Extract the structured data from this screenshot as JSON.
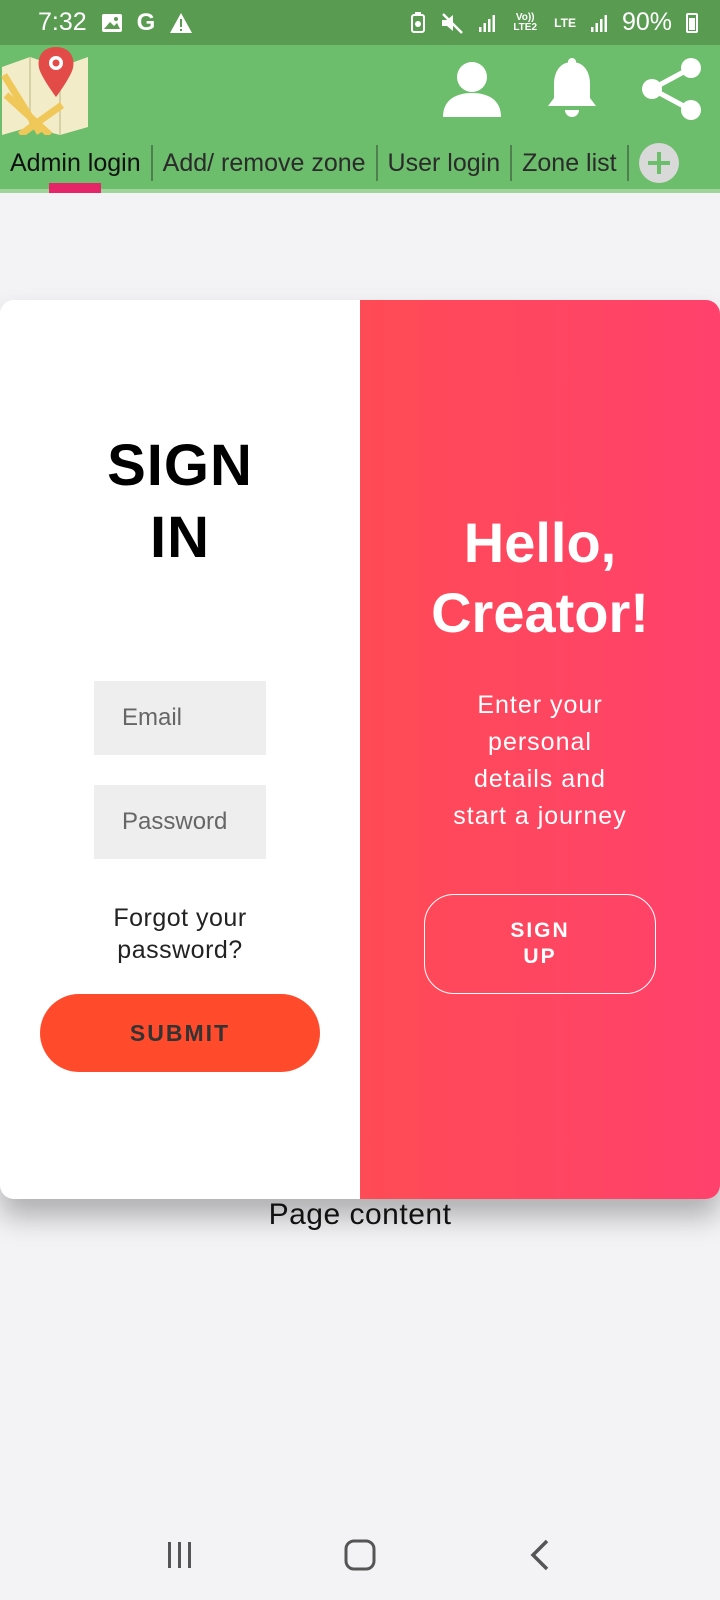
{
  "status_bar": {
    "time": "7:32",
    "battery": "90%",
    "icons": [
      "image-icon",
      "google-icon",
      "warning-icon",
      "cast-icon",
      "mute-icon",
      "signal-icon",
      "volte-icon",
      "lte-icon",
      "signal-icon-2",
      "battery-icon"
    ],
    "volte_label": "Vo)) LTE2",
    "lte_label": "LTE"
  },
  "app_bar": {
    "background_color": "#6cbd6c",
    "icons": [
      "map-logo-icon",
      "user-icon",
      "bell-icon",
      "share-icon"
    ],
    "tabs": [
      {
        "label": "Admin login",
        "active": true
      },
      {
        "label": "Add/ remove zone",
        "active": false
      },
      {
        "label": "User login",
        "active": false
      },
      {
        "label": "Zone list",
        "active": false
      }
    ],
    "add_tab_icon": "plus-icon",
    "active_indicator_color": "#e52567"
  },
  "signin": {
    "title_line1": "SIGN",
    "title_line2": "IN",
    "email_placeholder": "Email",
    "password_placeholder": "Password",
    "forgot_line1": "Forgot your",
    "forgot_line2": "password?",
    "submit_label": "SUBMIT",
    "submit_color": "#ff4b2b"
  },
  "welcome": {
    "title_line1": "Hello,",
    "title_line2": "Creator!",
    "subtitle_lines": [
      "Enter your",
      "personal",
      "details and",
      "start a journey"
    ],
    "signup_line1": "SIGN",
    "signup_line2": "UP",
    "gradient_colors": [
      "#ff4b55",
      "#ff416c"
    ]
  },
  "page_content_label": "Page content",
  "nav_bar": {
    "icons": [
      "recent-apps-icon",
      "home-icon",
      "back-icon"
    ]
  }
}
